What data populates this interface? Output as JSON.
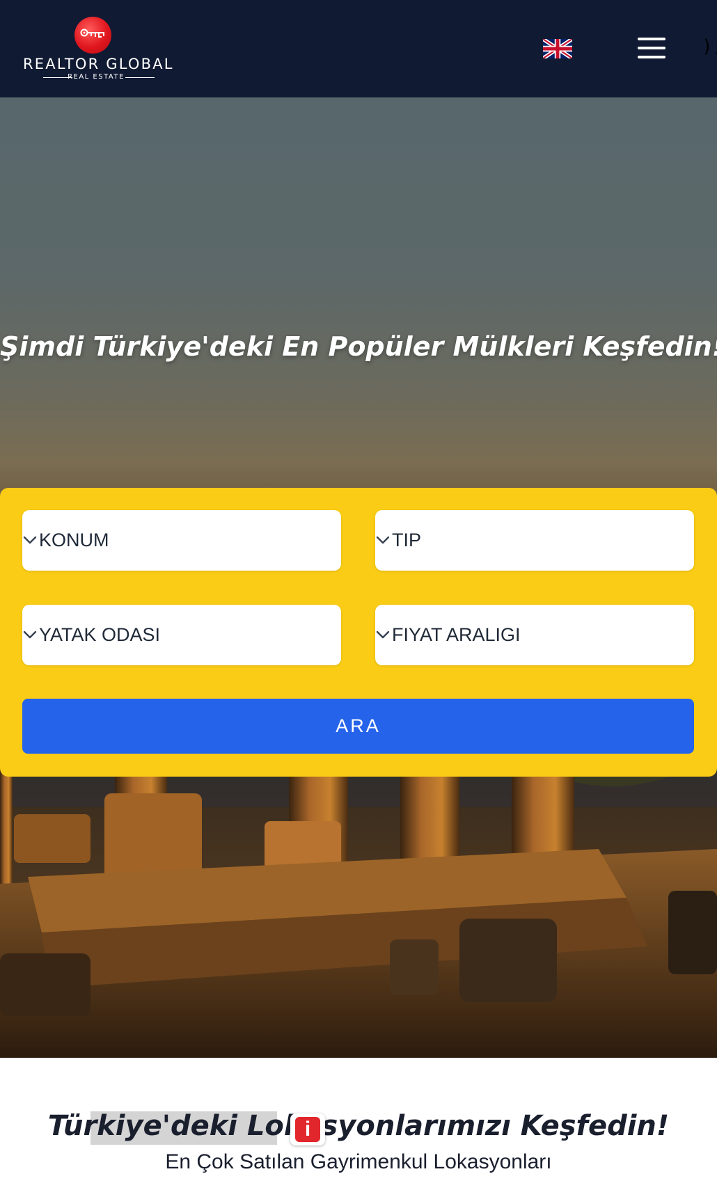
{
  "header": {
    "logo_title": "REALTOR GLOBAL",
    "logo_subtitle": "REAL ESTATE",
    "language_flag": "uk-flag-icon",
    "menu_icon": "hamburger-menu-icon",
    "stray_text": ");"
  },
  "hero": {
    "title": "Şimdi Türkiye'deki En Popüler Mülkleri Keşfedin!"
  },
  "search": {
    "location_label": "KONUM",
    "type_label": "TIP",
    "bedrooms_label": "YATAK ODASI",
    "price_label": "FIYAT ARALIGI",
    "submit_label": "ARA"
  },
  "locations": {
    "title": "Türkiye'deki Lokasyonlarımızı Keşfedin!",
    "subtitle": "En Çok Satılan Gayrimenkul Lokasyonları",
    "badge_letter": "i"
  },
  "colors": {
    "header_bg": "#111a33",
    "accent_yellow": "#facc15",
    "button_blue": "#2563eb",
    "logo_red": "#e0161e"
  }
}
